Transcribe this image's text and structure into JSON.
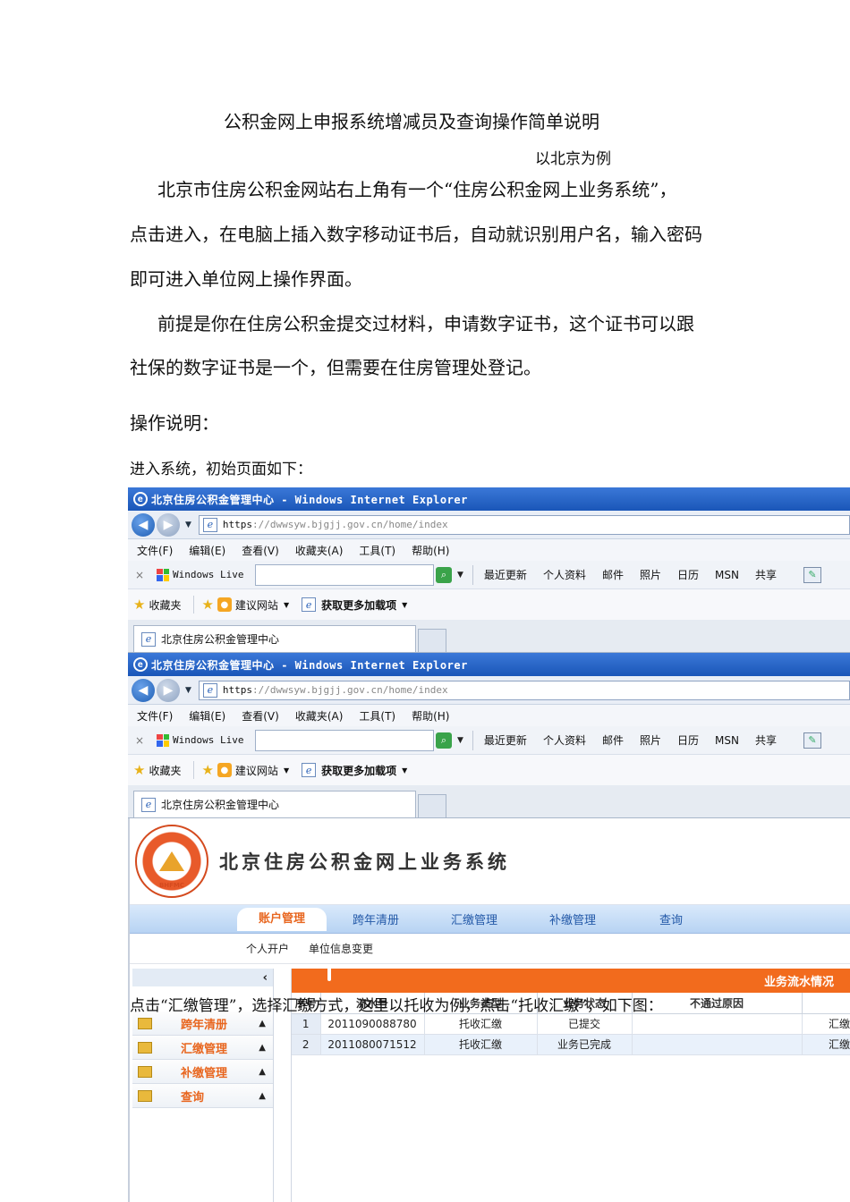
{
  "doc": {
    "title": "公积金网上申报系统增减员及查询操作简单说明",
    "subtitle_marker": "",
    "subtitle": "以北京为例",
    "para1_line1": "北京市住房公积金网站右上角有一个“住房公积金网上业务系统”，",
    "para1_line2": "点击进入，在电脑上插入数字移动证书后，自动就识别用户名，输入密码",
    "para1_line3": "即可进入单位网上操作界面。",
    "para2_line1": "前提是你在住房公积金提交过材料，申请数字证书，这个证书可以跟",
    "para2_line2": "社保的数字证书是一个，但需要在住房管理处登记。",
    "heading": "操作说明：",
    "intro": "进入系统，初始页面如下：",
    "overlay": "点击“汇缴管理”，选择汇缴方式，这里以托收为例，点击“托收汇缴”，如下图："
  },
  "browser": {
    "title": "北京住房公积金管理中心 - Windows Internet Explorer",
    "address_prefix": "https",
    "address_rest": "://dwwsyw.bjgjj.gov.cn/home/index",
    "menu": [
      "文件(F)",
      "编辑(E)",
      "查看(V)",
      "收藏夹(A)",
      "工具(T)",
      "帮助(H)"
    ],
    "live_label": "Windows Live",
    "live_links": [
      "最近更新",
      "个人资料",
      "邮件",
      "照片",
      "日历",
      "MSN",
      "共享"
    ],
    "fav_label": "收藏夹",
    "suggest_label": "建议网站",
    "addons_label": "获取更多加载项",
    "tab_label": "北京住房公积金管理中心"
  },
  "site": {
    "title": "北京住房公积金网上业务系统",
    "logo_abbr": "BHFMC",
    "nav": [
      "账户管理",
      "跨年清册",
      "汇缴管理",
      "补缴管理",
      "查询"
    ],
    "subnav": [
      "个人开户",
      "单位信息变更"
    ],
    "sidebar": [
      "跨年清册",
      "汇缴管理",
      "补缴管理",
      "查询"
    ],
    "panel_title": "业务流水情况",
    "table_headers": [
      "序号",
      "流水号",
      "业务类型",
      "业务状态",
      "不通过原因",
      ""
    ],
    "rows": [
      [
        "1",
        "2011090088780",
        "托收汇缴",
        "已提交",
        "",
        "汇缴"
      ],
      [
        "2",
        "2011080071512",
        "托收汇缴",
        "业务已完成",
        "",
        "汇缴"
      ]
    ]
  }
}
